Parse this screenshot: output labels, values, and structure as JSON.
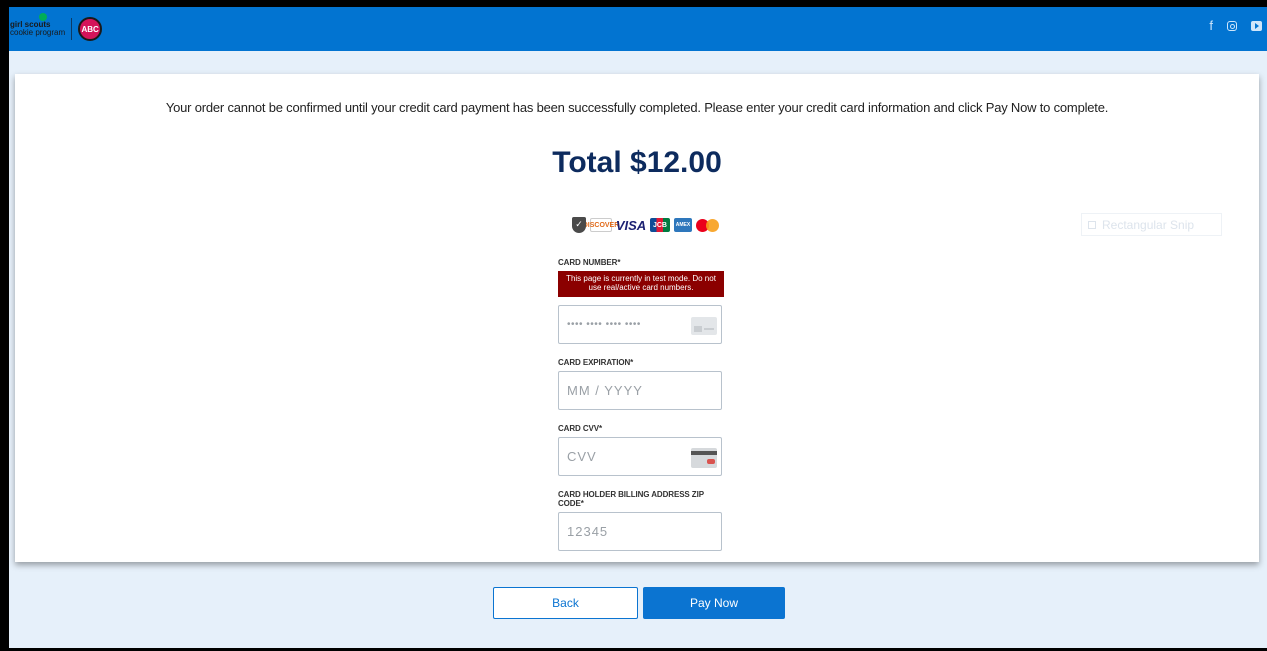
{
  "header": {
    "logo_line1": "girl scouts",
    "logo_line2": "cookie program",
    "abc_logo_text": "ABC",
    "social_icons": [
      "facebook-icon",
      "instagram-icon",
      "youtube-icon"
    ],
    "facebook_glyph": "f"
  },
  "main": {
    "notice": "Your order cannot be confirmed until your credit card payment has been successfully completed. Please enter your credit card information and click Pay Now to complete.",
    "total": "Total $12.00",
    "card_brands": [
      "discover",
      "visa",
      "jcb",
      "amex",
      "mastercard"
    ],
    "visa_text": "VISA",
    "discover_text": "DISCOVER",
    "jcb_text": "JCB",
    "amex_text": "AMEX",
    "snip_text": "Rectangular Snip"
  },
  "form": {
    "card_number_label": "CARD NUMBER*",
    "test_mode_banner": "This page is currently in test mode. Do not use real/active card numbers.",
    "card_number_placeholder": "•••• •••• •••• ••••",
    "expiration_label": "CARD EXPIRATION*",
    "expiration_placeholder": "MM / YYYY",
    "cvv_label": "CARD CVV*",
    "cvv_placeholder": "CVV",
    "zip_label": "CARD HOLDER BILLING ADDRESS ZIP CODE*",
    "zip_placeholder": "12345"
  },
  "footer": {
    "back_label": "Back",
    "pay_label": "Pay Now"
  },
  "colors": {
    "header_blue": "#0274d1",
    "total_navy": "#0d2b5e",
    "test_banner_red": "#8b0000",
    "button_blue": "#0b74d1"
  }
}
